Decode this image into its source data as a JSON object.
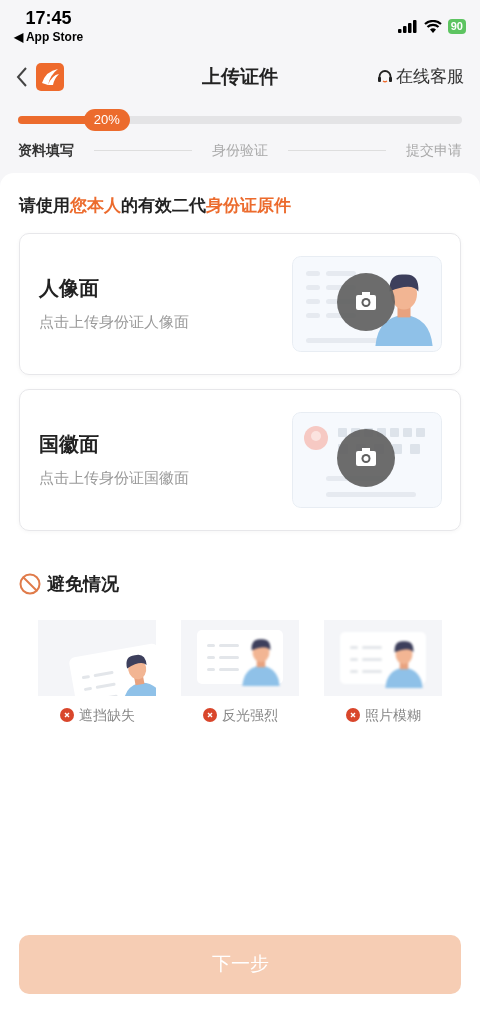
{
  "status_bar": {
    "time": "17:45",
    "back_app": "◀ App Store",
    "battery": "90"
  },
  "nav": {
    "title": "上传证件",
    "service": "在线客服"
  },
  "progress": {
    "level": 0.2,
    "reading": "20%"
  },
  "steps": [
    {
      "label": "资料填写",
      "selected": true
    },
    {
      "label": "身份验证",
      "selected": false
    },
    {
      "label": "提交申请",
      "selected": false
    }
  ],
  "heading": "请使用**您本人**的有效二代**身份证原件**",
  "uploads": [
    {
      "kind": "portrait",
      "title": "人像面",
      "hint": "点击上传身份证人像面"
    },
    {
      "kind": "emblem",
      "title": "国徽面",
      "hint": "点击上传身份证国徽面"
    }
  ],
  "avoid": {
    "title": "避免情况",
    "items": [
      {
        "kind": "tilted",
        "label": "遮挡缺失"
      },
      {
        "kind": "glare",
        "label": "反光强烈"
      },
      {
        "kind": "blurry",
        "label": "照片模糊"
      }
    ]
  },
  "next_button": {
    "label": "下一步",
    "disabled": true
  }
}
